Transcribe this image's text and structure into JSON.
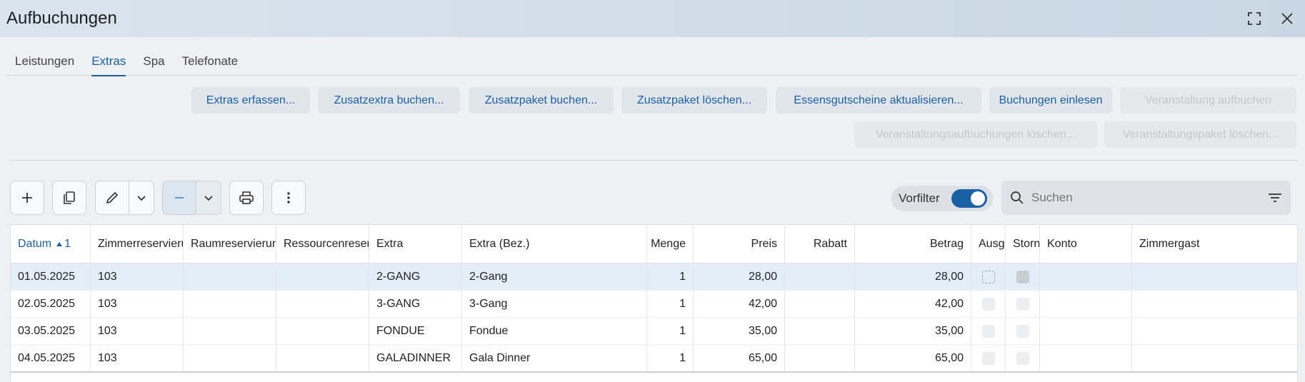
{
  "window": {
    "title": "Aufbuchungen"
  },
  "tabs": [
    {
      "label": "Leistungen",
      "active": false
    },
    {
      "label": "Extras",
      "active": true
    },
    {
      "label": "Spa",
      "active": false
    },
    {
      "label": "Telefonate",
      "active": false
    }
  ],
  "actions": {
    "extras_erfassen": "Extras erfassen...",
    "zusatzextra_buchen": "Zusatzextra buchen...",
    "zusatzpaket_buchen": "Zusatzpaket buchen...",
    "zusatzpaket_loeschen": "Zusatzpaket löschen...",
    "essensgutscheine": "Essensgutscheine aktualisieren...",
    "buchungen_einlesen": "Buchungen einlesen",
    "veranstaltung_aufbuchen": "Veranstaltung aufbuchen",
    "veranstaltungsaufbuchungen_loeschen": "Veranstaltungsaufbuchungen löschen...",
    "veranstaltungspaket_loeschen": "Veranstaltungspaket löschen..."
  },
  "toolbar": {
    "vorfilter_label": "Vorfilter",
    "vorfilter_on": true,
    "search_placeholder": "Suchen"
  },
  "table": {
    "sort_indicator": "1",
    "columns": {
      "datum": "Datum",
      "zimmer": "Zimmerreservierung",
      "raum": "Raumreservierung",
      "ressource": "Ressourcenreservierung",
      "extra": "Extra",
      "extra_bez": "Extra (Bez.)",
      "menge": "Menge",
      "preis": "Preis",
      "rabatt": "Rabatt",
      "betrag": "Betrag",
      "ausgl": "Ausgl",
      "storn": "Storn",
      "konto": "Konto",
      "zimmergast": "Zimmergast"
    },
    "rows": [
      {
        "datum": "01.05.2025",
        "zimmer": "103",
        "raum": "",
        "ressource": "",
        "extra": "2-GANG",
        "extra_bez": "2-Gang",
        "menge": "1",
        "preis": "28,00",
        "rabatt": "",
        "betrag": "28,00",
        "konto": "",
        "zimmergast": ""
      },
      {
        "datum": "02.05.2025",
        "zimmer": "103",
        "raum": "",
        "ressource": "",
        "extra": "3-GANG",
        "extra_bez": "3-Gang",
        "menge": "1",
        "preis": "42,00",
        "rabatt": "",
        "betrag": "42,00",
        "konto": "",
        "zimmergast": ""
      },
      {
        "datum": "03.05.2025",
        "zimmer": "103",
        "raum": "",
        "ressource": "",
        "extra": "FONDUE",
        "extra_bez": "Fondue",
        "menge": "1",
        "preis": "35,00",
        "rabatt": "",
        "betrag": "35,00",
        "konto": "",
        "zimmergast": ""
      },
      {
        "datum": "04.05.2025",
        "zimmer": "103",
        "raum": "",
        "ressource": "",
        "extra": "GALADINNER",
        "extra_bez": "Gala Dinner",
        "menge": "1",
        "preis": "65,00",
        "rabatt": "",
        "betrag": "65,00",
        "konto": "",
        "zimmergast": ""
      }
    ]
  },
  "colors": {
    "accent": "#1b5fa5",
    "selected_row": "#e3eef9"
  }
}
